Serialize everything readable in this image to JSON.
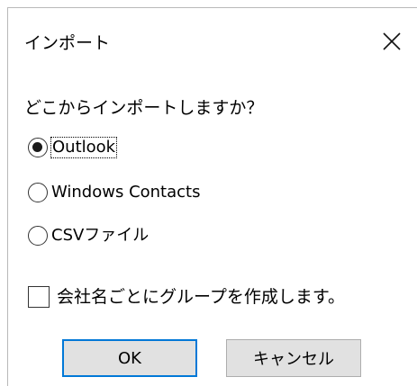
{
  "dialog": {
    "title": "インポート",
    "close_label": "close",
    "question": "どこからインポートしますか？",
    "options": [
      {
        "label": "Outlook",
        "checked": true
      },
      {
        "label": "Windows Contacts",
        "checked": false
      },
      {
        "label": "CSVファイル",
        "checked": false
      }
    ],
    "group_checkbox": {
      "label": "会社名ごとにグループを作成します。",
      "checked": false
    },
    "buttons": {
      "ok": "OK",
      "cancel": "キャンセル"
    }
  },
  "colors": {
    "default_button_border": "#0078d7",
    "button_bg": "#e1e1e1",
    "window_border": "#b9b9b9"
  }
}
